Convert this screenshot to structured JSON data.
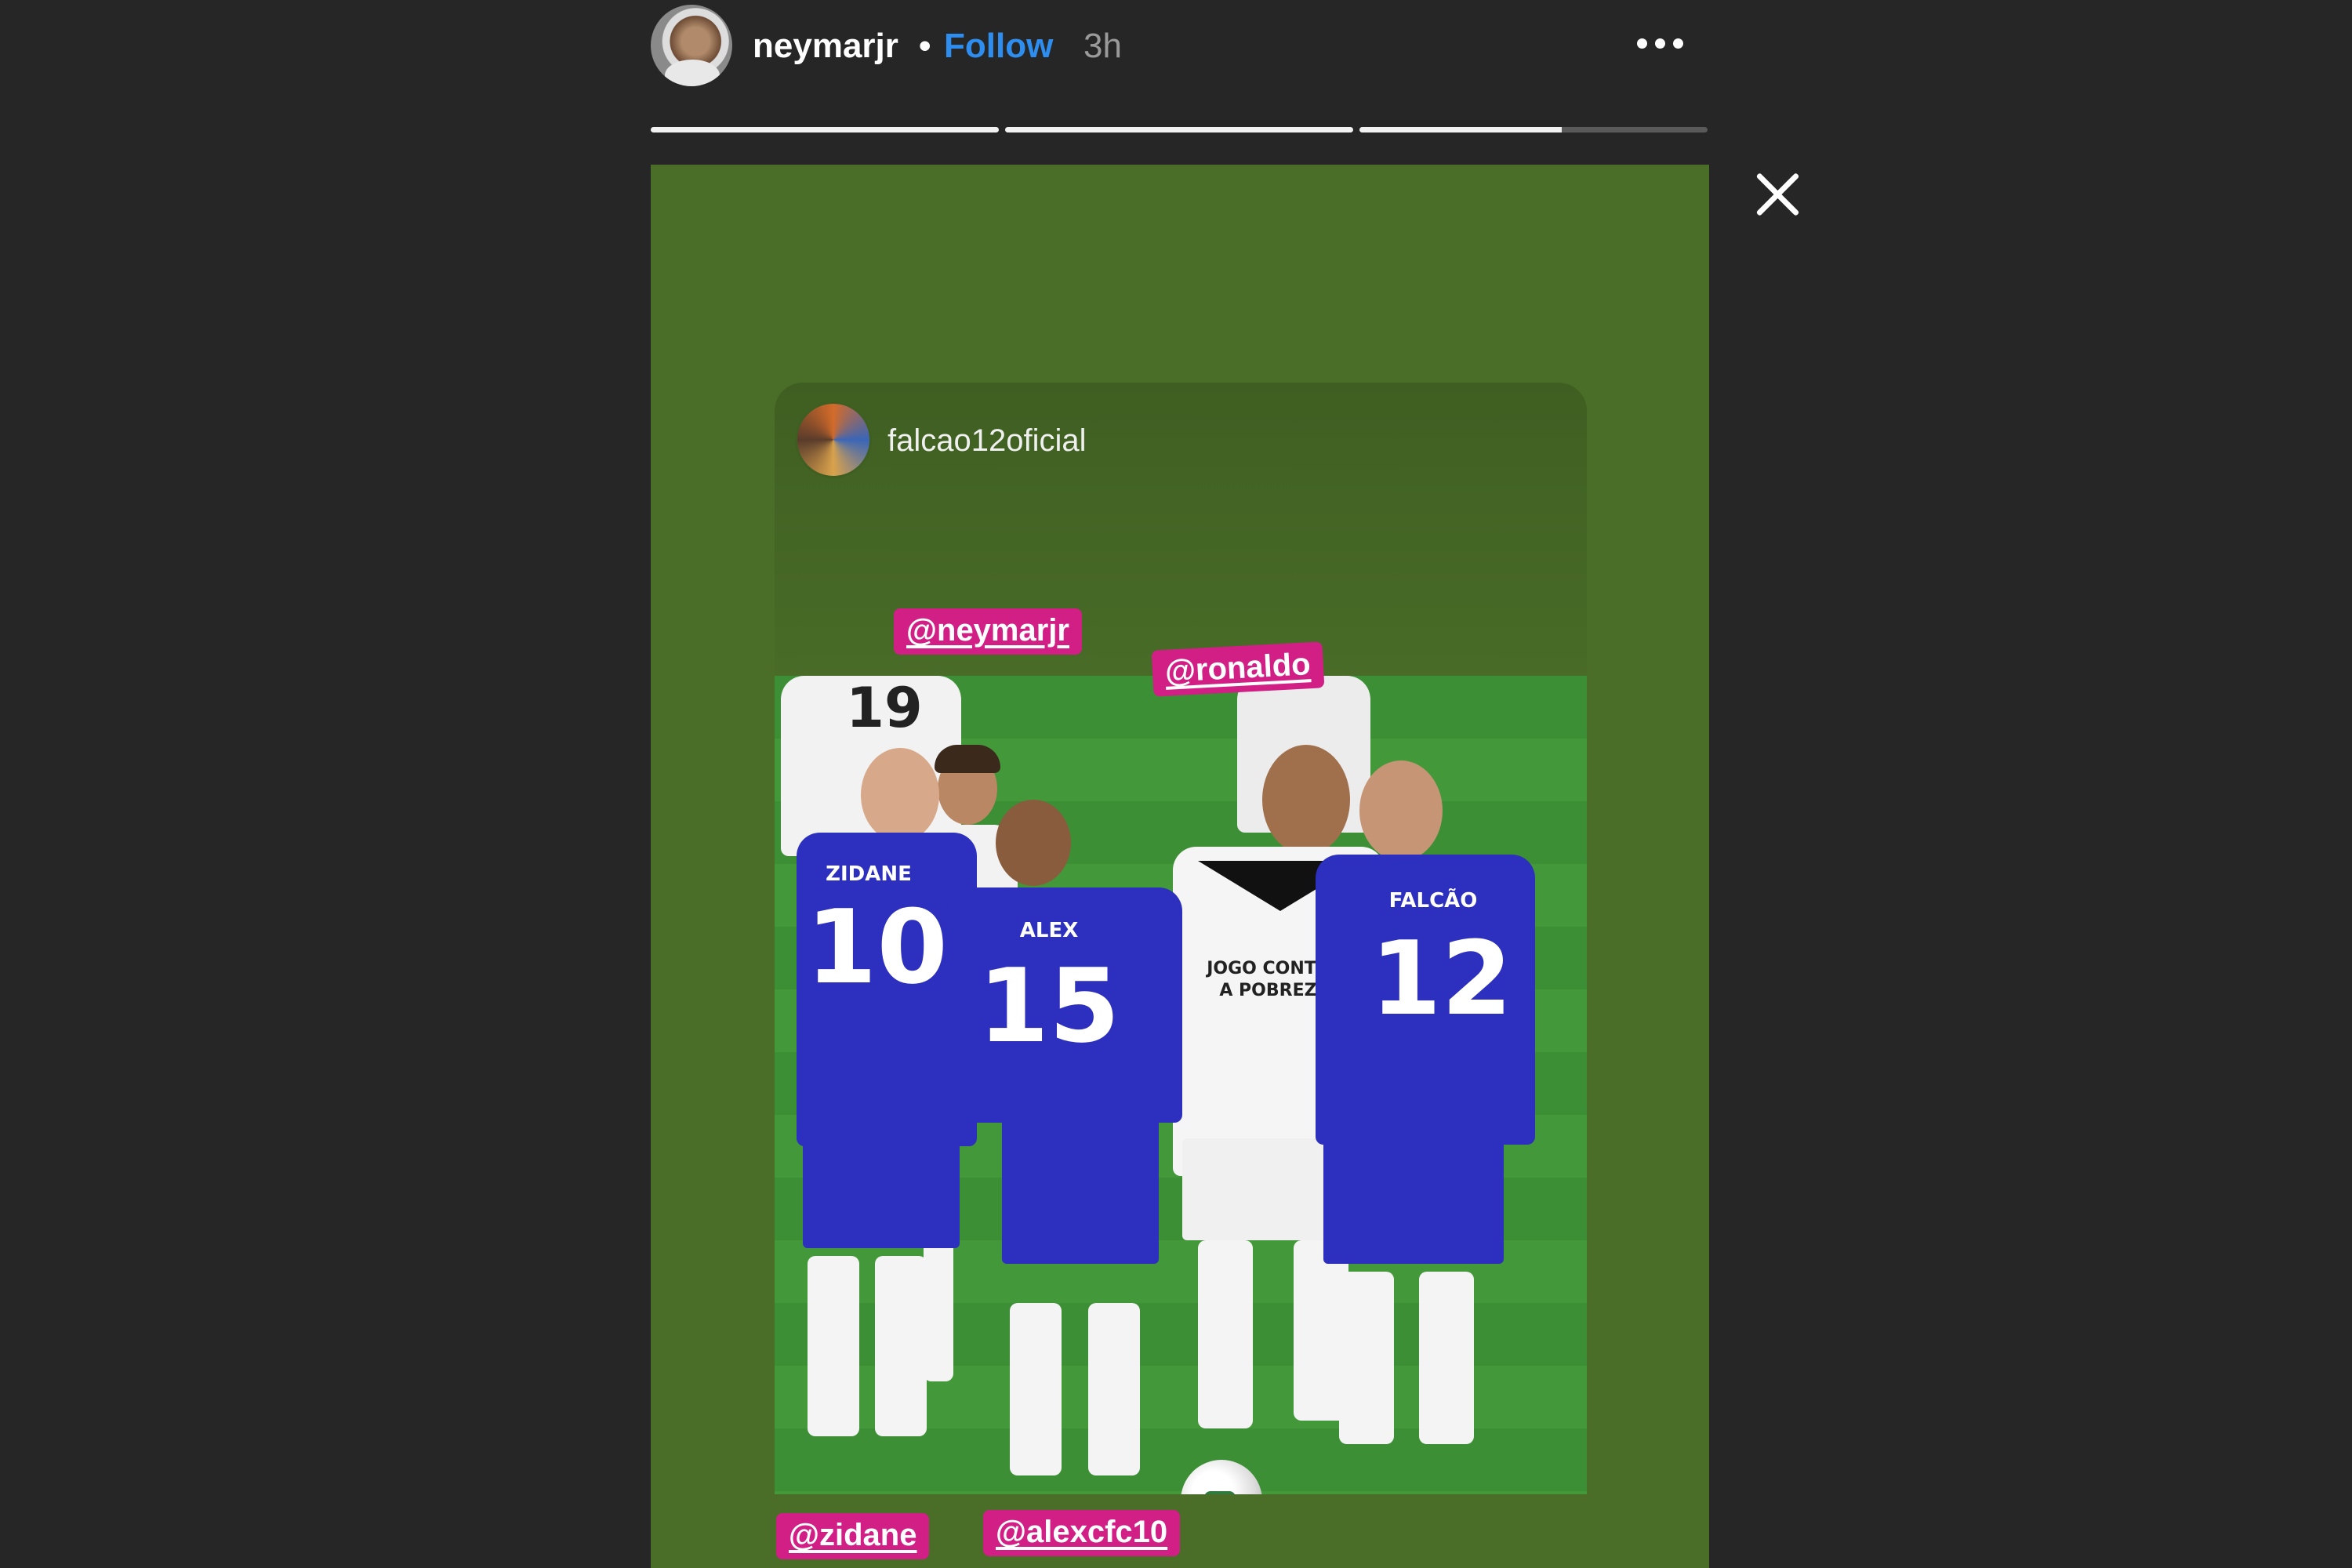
{
  "header": {
    "username": "neymarjr",
    "separator": "•",
    "follow_label": "Follow",
    "time": "3h"
  },
  "progress": [
    1.0,
    1.0,
    0.58
  ],
  "repost": {
    "username": "falcao12oficial"
  },
  "photo": {
    "players": [
      {
        "shirt_name": "ZIDANE",
        "number": "10"
      },
      {
        "shirt_name": "ALEX",
        "number": "15"
      },
      {
        "shirt_name": "FALCÃO",
        "number": "12"
      },
      {
        "number": "19"
      }
    ],
    "center_shirt_text": "JOGO CONTRA A POBREZA"
  },
  "tags": {
    "neymarjr": "@neymarjr",
    "ronaldo": "@ronaldo",
    "zidane": "@zidane",
    "alexcfc10": "@alexcfc10"
  },
  "colors": {
    "background": "#262626",
    "story_background": "#4a6d28",
    "follow_blue": "#2e8ef0",
    "tag_pink": "#d11f86",
    "jersey_blue": "#2d2fbf"
  },
  "icons": [
    "more-options-icon",
    "close-icon"
  ]
}
